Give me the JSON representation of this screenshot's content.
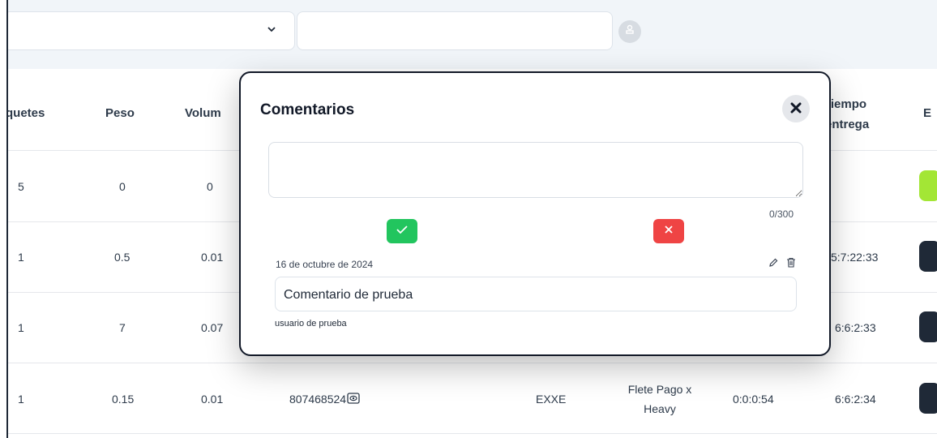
{
  "filters": {
    "select_value": "",
    "text_value": ""
  },
  "table": {
    "headers": {
      "paquetes": "quetes",
      "peso": "Peso",
      "volumen": "Volum",
      "tiempo_entrega": [
        "Tiempo",
        "entrega"
      ],
      "estado": "E"
    },
    "rows": [
      {
        "paquetes": "5",
        "peso": "0",
        "volumen": "0",
        "guia": "",
        "carrier": "",
        "servicio": "",
        "tiempo1": "",
        "tiempo_entrega": "",
        "status_color": "#a3e635"
      },
      {
        "paquetes": "1",
        "peso": "0.5",
        "volumen": "0.01",
        "guia": "",
        "carrier": "",
        "servicio": "",
        "tiempo1": "",
        "tiempo_entrega": "5:7:22:33",
        "status_color": "#1f2937"
      },
      {
        "paquetes": "1",
        "peso": "7",
        "volumen": "0.07",
        "guia": "",
        "carrier": "",
        "servicio": "",
        "tiempo1": "",
        "tiempo_entrega": "6:6:2:33",
        "status_color": "#1f2937"
      },
      {
        "paquetes": "1",
        "peso": "0.15",
        "volumen": "0.01",
        "guia": "807468524",
        "carrier": "EXXE",
        "servicio": [
          "Flete Pago x",
          "Heavy"
        ],
        "tiempo1": "0:0:0:54",
        "tiempo_entrega": "6:6:2:34",
        "status_color": "#1f2937"
      }
    ]
  },
  "modal": {
    "title": "Comentarios",
    "comment_input_value": "",
    "counter": "0/300",
    "comments": [
      {
        "date": "16 de octubre de 2024",
        "text": "Comentario de prueba",
        "author": "usuario de prueba"
      }
    ]
  }
}
